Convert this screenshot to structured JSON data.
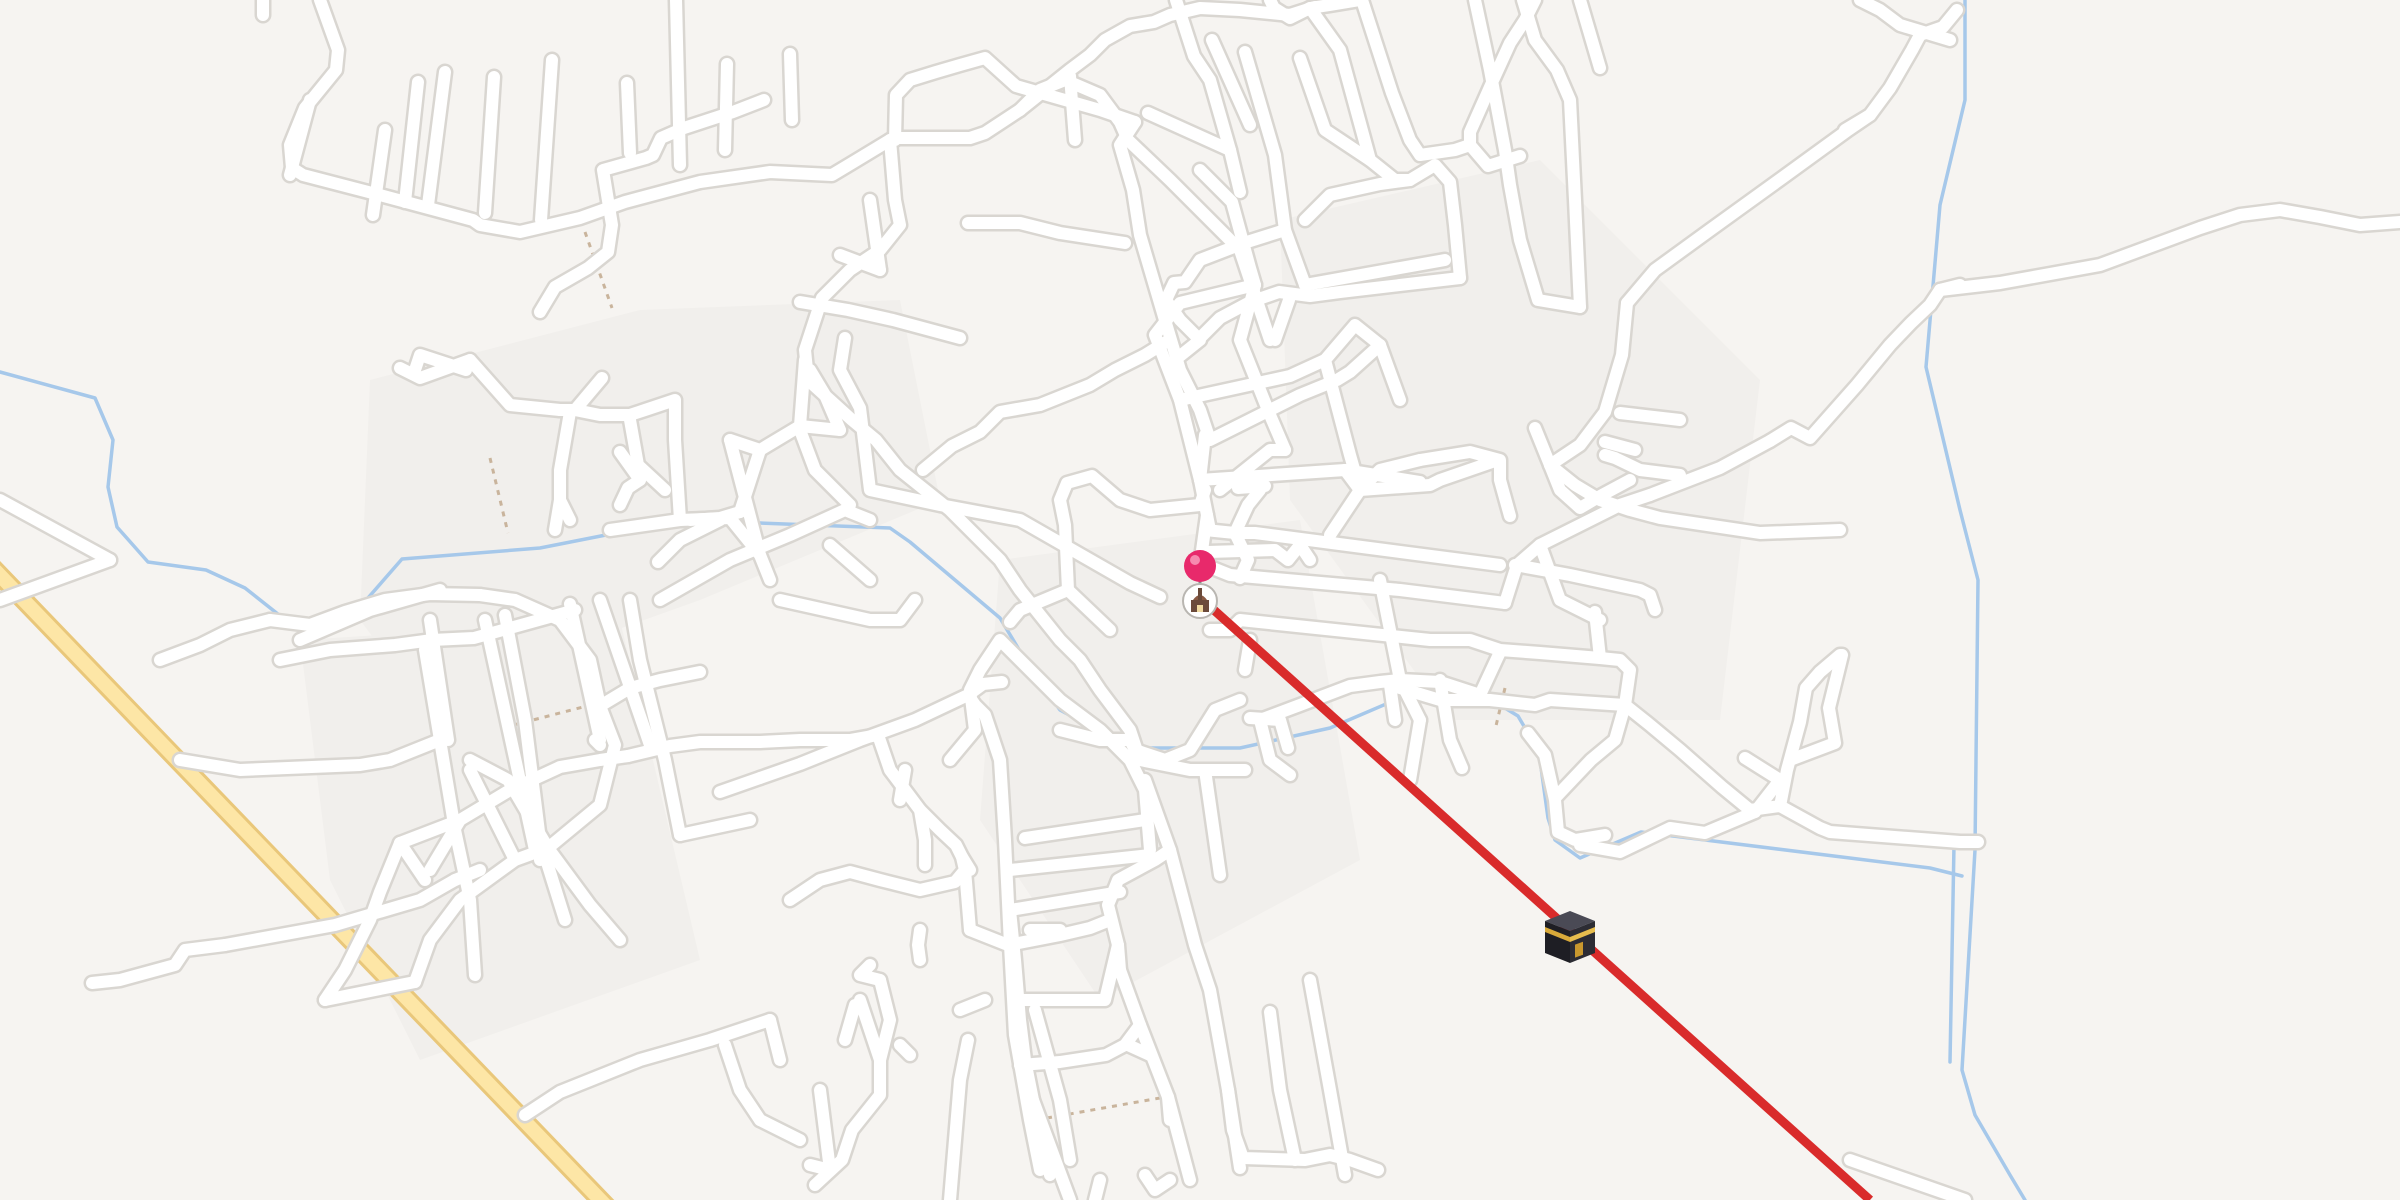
{
  "map": {
    "type": "qibla-direction-map",
    "colors": {
      "background": "#f6f4f1",
      "road": "#ffffff",
      "road_casing": "#d9d6d1",
      "water": "#a6c8ea",
      "highway": "#fde6a6",
      "qibla_line": "#d92b2b",
      "pin": "#e8296b"
    },
    "markers": {
      "location_pin": {
        "icon": "location-pin-icon"
      },
      "mosque": {
        "icon": "mosque-icon"
      },
      "kaaba": {
        "icon": "kaaba-icon"
      }
    },
    "qibla_line": {
      "visible": true
    }
  }
}
